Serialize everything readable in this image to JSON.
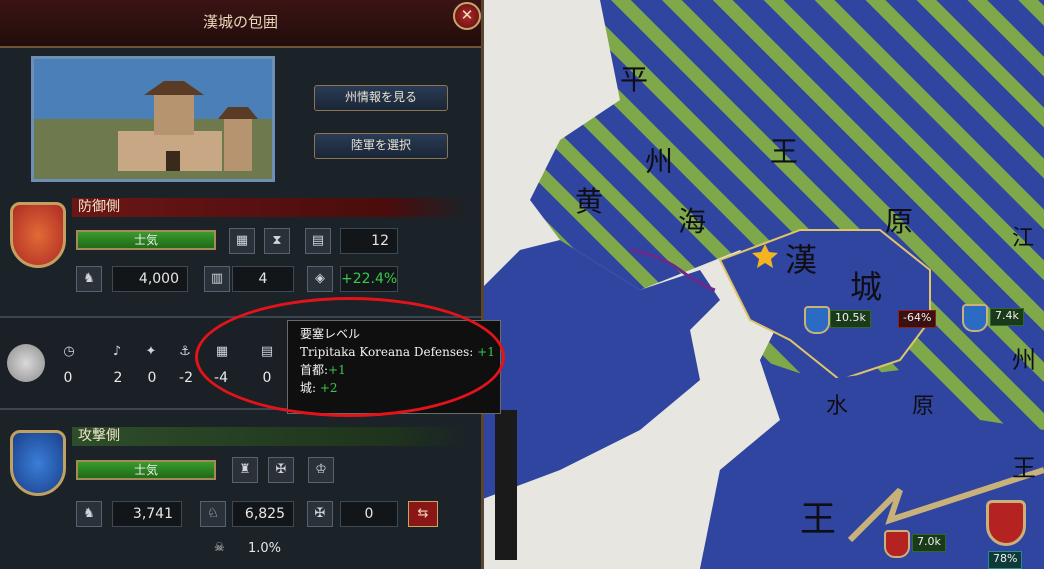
{
  "window": {
    "title": "漢城の包囲",
    "close_icon": "close-icon"
  },
  "nav": {
    "province_info": "州情報を見る",
    "select_army": "陸軍を選択"
  },
  "defender": {
    "label": "防御側",
    "morale": "士気",
    "fort_value": "12",
    "troops": "4,000",
    "garrison_count": "4",
    "bonus": "+22.4%"
  },
  "siege_stats": {
    "dice": "0",
    "v1": "2",
    "v2": "0",
    "v3": "-2",
    "v4": "-4",
    "v5": "0"
  },
  "tooltip": {
    "title": "要塞レベル",
    "line1_label": "Tripitaka Koreana Defenses:",
    "line1_value": "+1",
    "line2_label": "首都:",
    "line2_value": "+1",
    "line3_label": "城:",
    "line3_value": "+2"
  },
  "attacker": {
    "label": "攻撃側",
    "morale": "士気",
    "infantry": "3,741",
    "cavalry": "6,825",
    "artillery": "0",
    "loss": "1.0%"
  },
  "map": {
    "labels": [
      "平",
      "州",
      "黄",
      "海",
      "王",
      "原",
      "漢",
      "城",
      "江",
      "州",
      "水",
      "原",
      "王",
      "王"
    ],
    "units": [
      {
        "strength": "10.5k",
        "side": "defender"
      },
      {
        "progress": "-64%"
      },
      {
        "strength": "7.4k",
        "side": "defender"
      },
      {
        "strength": "7.0k",
        "side": "attacker"
      },
      {
        "progress": "78%"
      }
    ]
  },
  "colors": {
    "stripe_green": "#7fa84a",
    "sea": "#2b3f8e",
    "accent_red": "#e2141a",
    "positive": "#38c94a"
  }
}
